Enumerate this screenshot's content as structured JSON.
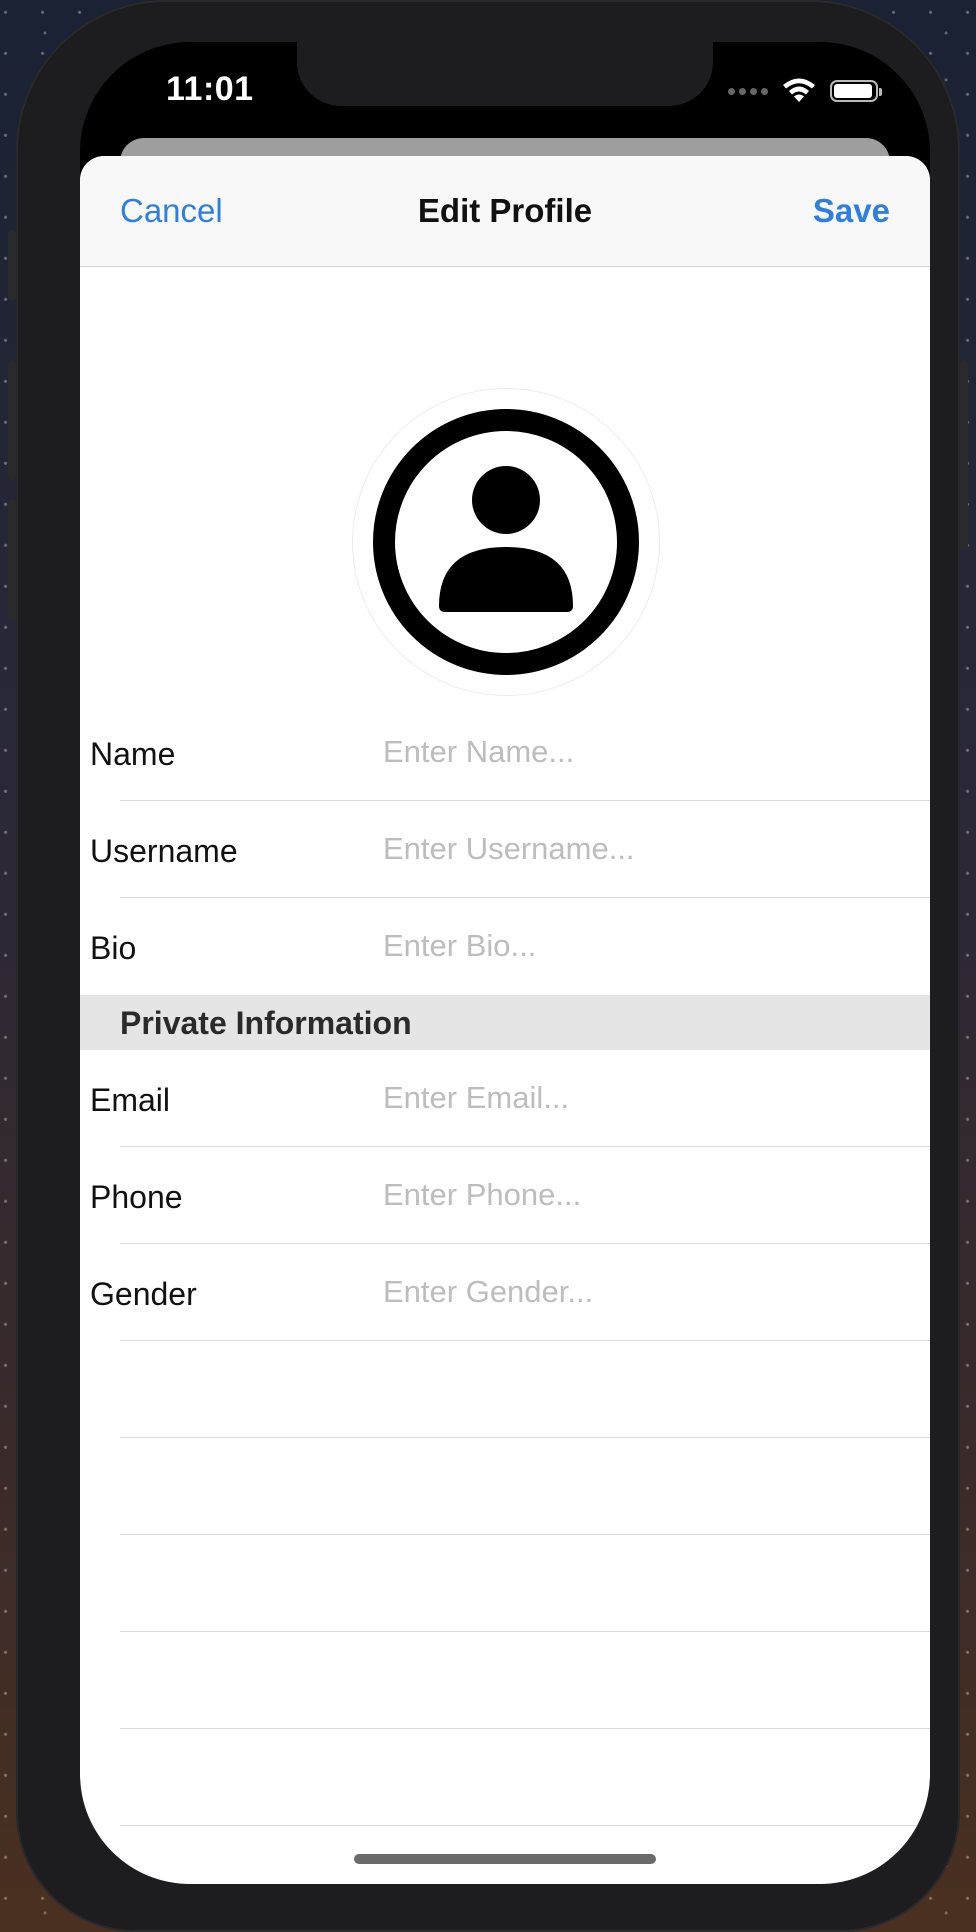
{
  "status_bar": {
    "time": "11:01",
    "wifi_icon": "wifi-icon",
    "battery_icon": "battery-icon"
  },
  "navbar": {
    "cancel_label": "Cancel",
    "title": "Edit Profile",
    "save_label": "Save"
  },
  "avatar": {
    "icon": "person-circle-icon"
  },
  "public_fields": [
    {
      "label": "Name",
      "placeholder": "Enter Name..."
    },
    {
      "label": "Username",
      "placeholder": "Enter Username..."
    },
    {
      "label": "Bio",
      "placeholder": "Enter Bio..."
    }
  ],
  "private_section": {
    "title": "Private Information",
    "fields": [
      {
        "label": "Email",
        "placeholder": "Enter Email..."
      },
      {
        "label": "Phone",
        "placeholder": "Enter Phone..."
      },
      {
        "label": "Gender",
        "placeholder": "Enter Gender..."
      }
    ]
  },
  "colors": {
    "accent": "#2f7fe0",
    "placeholder": "#bdbdbd",
    "section_bg": "#e5e5e5"
  }
}
